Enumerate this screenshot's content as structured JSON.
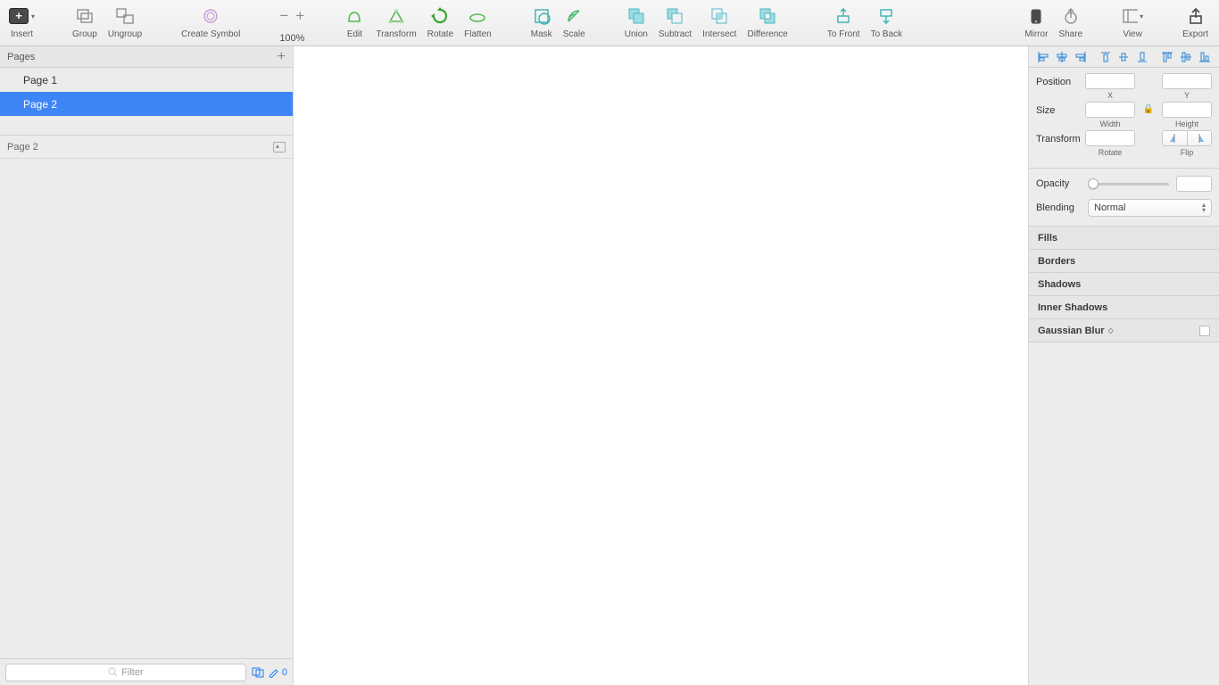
{
  "toolbar": {
    "insert": "Insert",
    "group": "Group",
    "ungroup": "Ungroup",
    "create_symbol": "Create Symbol",
    "zoom": "100%",
    "edit": "Edit",
    "transform": "Transform",
    "rotate": "Rotate",
    "flatten": "Flatten",
    "mask": "Mask",
    "scale": "Scale",
    "union": "Union",
    "subtract": "Subtract",
    "intersect": "Intersect",
    "difference": "Difference",
    "to_front": "To Front",
    "to_back": "To Back",
    "mirror": "Mirror",
    "share": "Share",
    "view": "View",
    "export": "Export"
  },
  "left": {
    "pages_title": "Pages",
    "pages": [
      "Page 1",
      "Page 2"
    ],
    "selected_page_index": 1,
    "layers_title": "Page 2",
    "filter_placeholder": "Filter",
    "footer_count": "0"
  },
  "inspector": {
    "align": [
      "align-left",
      "align-hcenter",
      "align-right",
      "distribute-left",
      "distribute-hcenter",
      "distribute-right",
      "align-top",
      "align-vcenter",
      "align-bottom"
    ],
    "position_label": "Position",
    "x_label": "X",
    "y_label": "Y",
    "size_label": "Size",
    "width_label": "Width",
    "height_label": "Height",
    "transform_label": "Transform",
    "rotate_label": "Rotate",
    "flip_label": "Flip",
    "opacity_label": "Opacity",
    "blending_label": "Blending",
    "blending_value": "Normal",
    "sections": {
      "fills": "Fills",
      "borders": "Borders",
      "shadows": "Shadows",
      "inner_shadows": "Inner Shadows",
      "gaussian_blur": "Gaussian Blur"
    },
    "values": {
      "x": "",
      "y": "",
      "width": "",
      "height": "",
      "rotate": "",
      "opacity": ""
    }
  }
}
